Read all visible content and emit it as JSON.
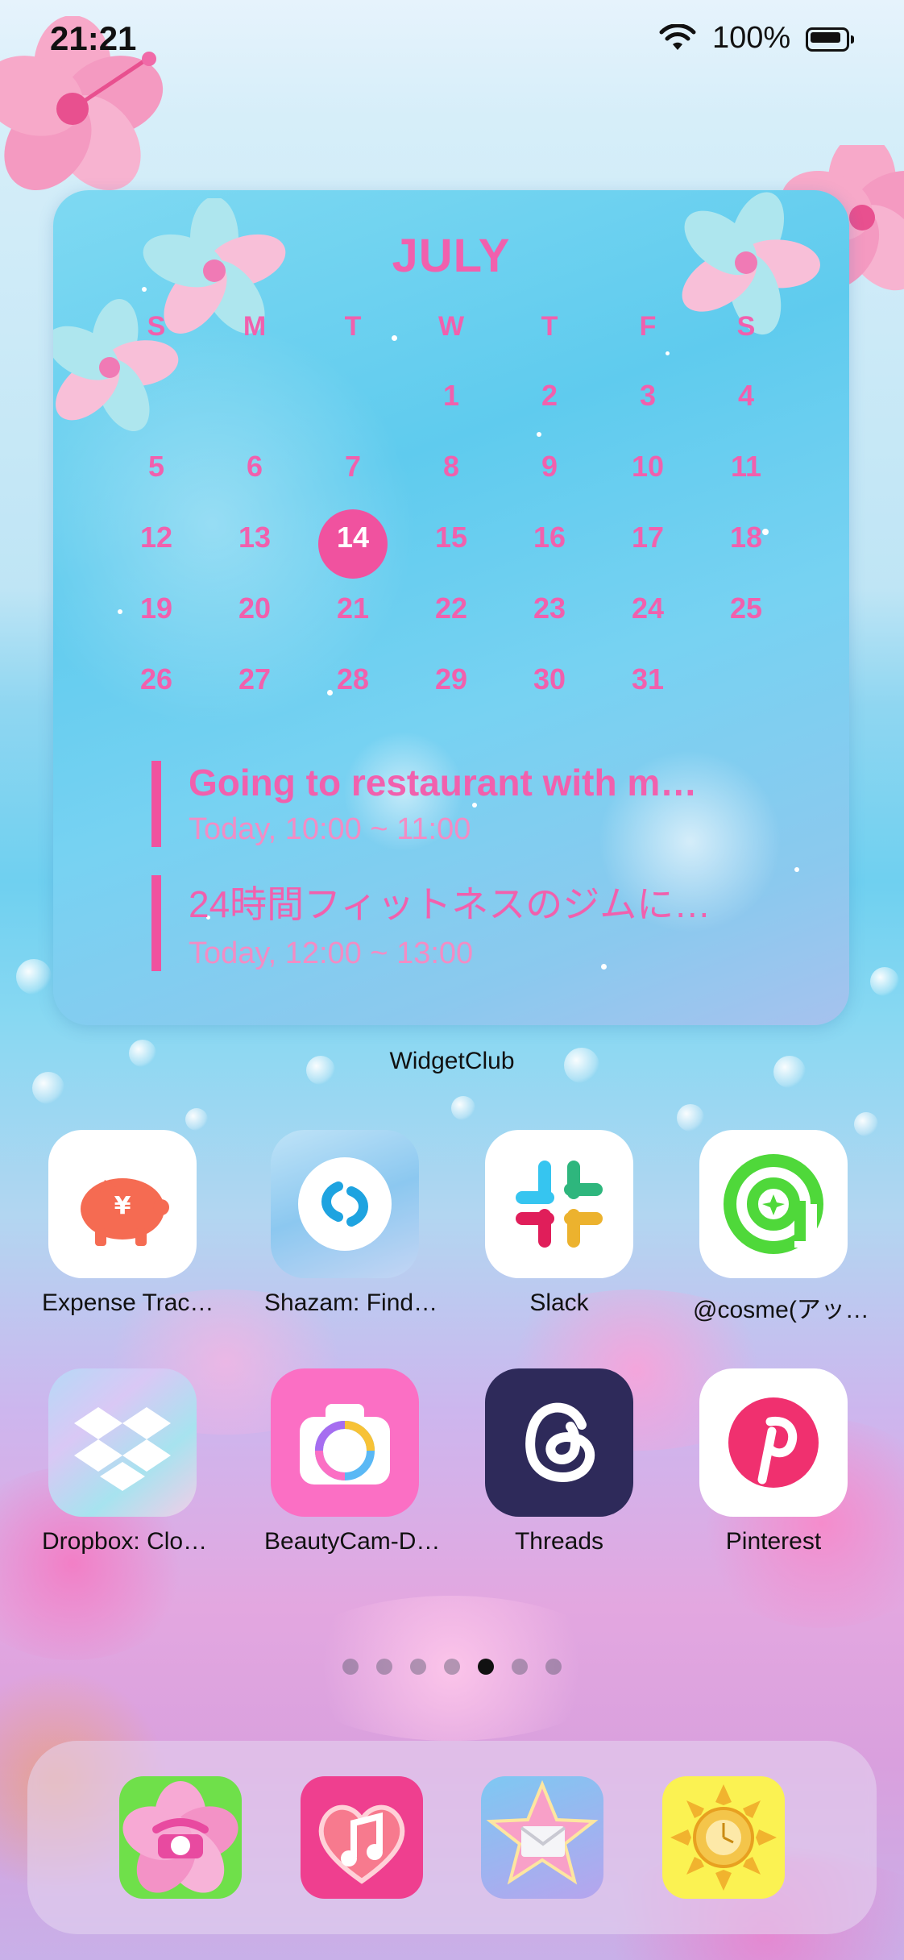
{
  "status_bar": {
    "time": "21:21",
    "battery_percent": "100%"
  },
  "calendar_widget": {
    "month": "JULY",
    "weekdays": [
      "S",
      "M",
      "T",
      "W",
      "T",
      "F",
      "S"
    ],
    "days": [
      "1",
      "2",
      "3",
      "4",
      "5",
      "6",
      "7",
      "8",
      "9",
      "10",
      "11",
      "12",
      "13",
      "14",
      "15",
      "16",
      "17",
      "18",
      "19",
      "20",
      "21",
      "22",
      "23",
      "24",
      "25",
      "26",
      "27",
      "28",
      "29",
      "30",
      "31"
    ],
    "today": "14",
    "events": [
      {
        "title": "Going to restaurant with m…",
        "time": "Today, 10:00 ~ 11:00"
      },
      {
        "title": "24時間フィットネスのジムに…",
        "time": "Today, 12:00 ~ 13:00"
      }
    ],
    "label": "WidgetClub",
    "accent_color": "#f160ad"
  },
  "apps": [
    {
      "label": "Expense Trac…",
      "icon": "piggy-bank-icon"
    },
    {
      "label": "Shazam: Find…",
      "icon": "shazam-icon"
    },
    {
      "label": "Slack",
      "icon": "slack-icon"
    },
    {
      "label": "@cosme(アッ…",
      "icon": "cosme-icon"
    },
    {
      "label": "Dropbox: Clo…",
      "icon": "dropbox-icon"
    },
    {
      "label": "BeautyCam-D…",
      "icon": "camera-icon"
    },
    {
      "label": "Threads",
      "icon": "threads-icon"
    },
    {
      "label": "Pinterest",
      "icon": "pinterest-icon"
    }
  ],
  "page_dots": {
    "count": 7,
    "active_index": 4
  },
  "dock": [
    {
      "icon": "phone-icon"
    },
    {
      "icon": "music-icon"
    },
    {
      "icon": "mail-icon"
    },
    {
      "icon": "compass-icon"
    }
  ]
}
